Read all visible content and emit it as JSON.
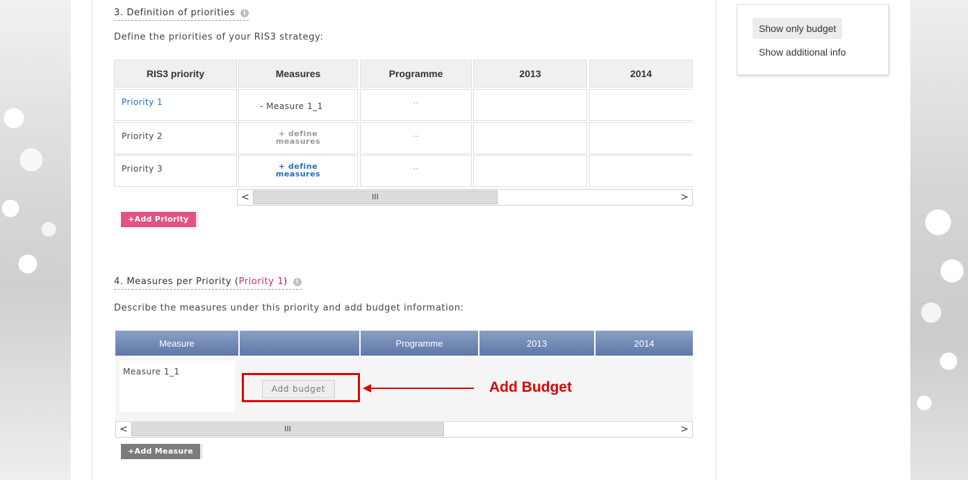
{
  "section3": {
    "title": "3. Definition of priorities",
    "info_icon": "info-icon",
    "description": "Define the priorities of your RIS3 strategy:",
    "headers": [
      "RIS3 priority",
      "Measures",
      "Programme",
      "2013",
      "2014"
    ],
    "rows": [
      {
        "priority": "Priority 1",
        "measures": "- Measure 1_1",
        "programme": "--"
      },
      {
        "priority": "Priority 2",
        "measures_l1": "+ define",
        "measures_l2": "measures",
        "programme": "--"
      },
      {
        "priority": "Priority 3",
        "measures_l1": "+ define",
        "measures_l2": "measures",
        "programme": "--"
      }
    ],
    "scroll_thumb": "III",
    "scroll_left": "<",
    "scroll_right": ">",
    "add_button": "+Add Priority"
  },
  "section4": {
    "title_prefix": "4. Measures per Priority (",
    "title_highlight": "Priority 1",
    "title_suffix": ")",
    "description": "Describe the measures under this priority and add budget information:",
    "headers": [
      "Measure",
      "",
      "Programme",
      "2013",
      "2014"
    ],
    "row": {
      "measure": "Measure 1_1",
      "budget_button": "Add budget"
    },
    "scroll_thumb": "III",
    "scroll_left": "<",
    "scroll_right": ">",
    "add_button": "+Add Measure"
  },
  "annotation": {
    "label": "Add Budget",
    "color": "#e00000"
  },
  "side_panel": {
    "items": [
      "Show only budget",
      "Show additional info"
    ]
  },
  "colors": {
    "accent_pink": "#d6266f",
    "link_blue": "#1f6fc4",
    "header_blue": "#6f86b4"
  }
}
